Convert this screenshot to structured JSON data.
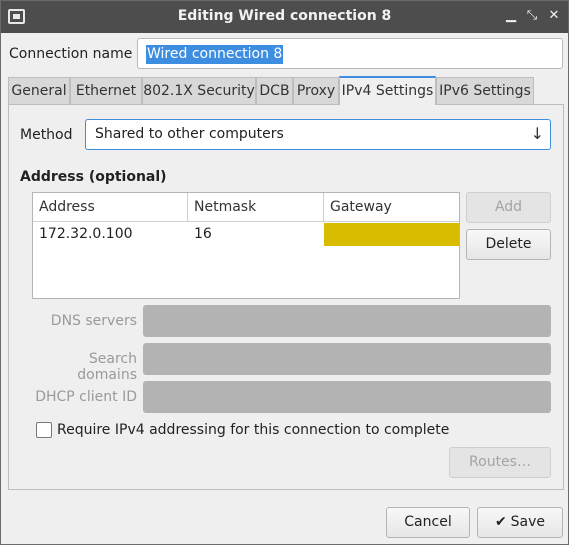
{
  "titlebar": {
    "title": "Editing Wired connection 8",
    "minimize_glyph": "▁",
    "maximize_glyph": "⤡",
    "close_glyph": "✕"
  },
  "connection": {
    "label": "Connection name",
    "value": "Wired connection 8"
  },
  "tabs": [
    {
      "label": "General"
    },
    {
      "label": "Ethernet"
    },
    {
      "label": "802.1X Security"
    },
    {
      "label": "DCB"
    },
    {
      "label": "Proxy"
    },
    {
      "label": "IPv4 Settings",
      "active": true
    },
    {
      "label": "IPv6 Settings"
    }
  ],
  "ipv4": {
    "method_label": "Method",
    "method_value": "Shared to other computers",
    "address_heading": "Address (optional)",
    "columns": [
      "Address",
      "Netmask",
      "Gateway"
    ],
    "rows": [
      {
        "address": "172.32.0.100",
        "netmask": "16",
        "gateway": ""
      }
    ],
    "add_label": "Add",
    "delete_label": "Delete",
    "dns_label": "DNS servers",
    "search_label": "Search domains",
    "dhcp_label": "DHCP client ID",
    "require_label": "Require IPv4 addressing for this connection to complete",
    "require_checked": false,
    "routes_label": "Routes…"
  },
  "footer": {
    "cancel_label": "Cancel",
    "save_label": "Save"
  },
  "colors": {
    "accent": "#3d8ee0",
    "titlebar": "#4d4d4d",
    "gateway_highlight": "#d9bb00"
  }
}
